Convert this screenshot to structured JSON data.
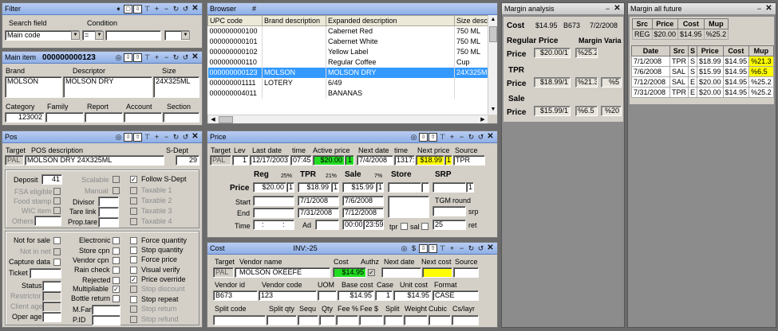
{
  "filter": {
    "title": "Filter",
    "search_field_label": "Search field",
    "condition_label": "Condition",
    "search_field_value": "Main code",
    "condition_value": "="
  },
  "main_item": {
    "title": "Main item",
    "code": "000000000123",
    "brand_label": "Brand",
    "descriptor_label": "Descriptor",
    "size_label": "Size",
    "brand": "MOLSON",
    "descriptor": "MOLSON DRY",
    "size": "24X325ML",
    "category_label": "Category",
    "family_label": "Family",
    "report_label": "Report",
    "account_label": "Account",
    "section_label": "Section",
    "category": "123002"
  },
  "pos": {
    "title": "Pos",
    "target_label": "Target",
    "pos_desc_label": "POS description",
    "sdept_label": "S-Dept",
    "target": "PAL",
    "pos_desc": "MOLSON DRY 24X325ML",
    "sdept": "29",
    "deposit_label": "Deposit",
    "deposit": "41",
    "fsa_label": "FSA eligible",
    "food_stamp_label": "Food stamp",
    "wic_label": "WIC item",
    "others_label": "Others",
    "scalable_label": "Scalable",
    "manual_label": "Manual",
    "divisor_label": "Divisor",
    "tare_link_label": "Tare link",
    "prop_tare_label": "Prop.tare",
    "follow_sdept_label": "Follow S-Dept",
    "taxables": [
      "Taxable 1",
      "Taxable 2",
      "Taxable 3",
      "Taxable 4"
    ],
    "not_for_sale_label": "Not for sale",
    "not_in_net_label": "Not in net",
    "capture_data_label": "Capture data",
    "ticket_label": "Ticket",
    "status_label": "Status",
    "restrictor_label": "Restrictor",
    "client_age_label": "Client age",
    "oper_age_label": "Oper age",
    "electronic_label": "Electronic",
    "store_cpn_label": "Store cpn",
    "vendor_cpn_label": "Vendor cpn",
    "rain_check_label": "Rain check",
    "rejected_label": "Rejected",
    "multipliable_label": "Multipliable",
    "bottle_return_label": "Bottle return",
    "mfam_label": "M.Fam.",
    "pid_label": "P.ID",
    "right_opts": [
      "Force quantity",
      "Stop quantity",
      "Force price",
      "Visual verify",
      "Price override",
      "Stop discount",
      "Stop repeat",
      "Stop return",
      "Stop refund"
    ]
  },
  "browser": {
    "title": "Browser",
    "hash": "#",
    "columns": [
      "UPC code",
      "Brand description",
      "Expanded description",
      "Size desc"
    ],
    "rows": [
      [
        "000000000100",
        "",
        "Cabernet Red",
        "750 ML"
      ],
      [
        "000000000101",
        "",
        "Cabernet White",
        "750 ML"
      ],
      [
        "000000000102",
        "",
        "Yellow Label",
        "750 ML"
      ],
      [
        "000000000110",
        "",
        "Regular Coffee",
        "Cup"
      ],
      [
        "000000000123",
        "MOLSON",
        "MOLSON DRY",
        "24X325M"
      ],
      [
        "000000001111",
        "LOTERY",
        "6/49",
        ""
      ],
      [
        "000000004011",
        "",
        "BANANAS",
        ""
      ]
    ]
  },
  "price": {
    "title": "Price",
    "target_label": "Target",
    "lev_label": "Lev",
    "last_date_label": "Last date",
    "time_label": "time",
    "active_price_label": "Active price",
    "next_date_label": "Next date",
    "next_price_label": "Next price",
    "source_label": "Source",
    "target": "PAL",
    "lev": "1",
    "last_date": "12/17/2003",
    "last_time": "07:45",
    "active_price": "$20.00",
    "active_qty": "1",
    "next_date": "7/4/2008",
    "next_time": "1317:",
    "next_price": "$18.99",
    "next_qty": "1",
    "source": "TPR",
    "reg_label": "Reg",
    "reg_pct": "25%",
    "tpr_label": "TPR",
    "tpr_pct": "21%",
    "sale_label": "Sale",
    "sale_pct": "7%",
    "store_label": "Store",
    "srp_label": "SRP",
    "price_label": "Price",
    "reg_price": "$20.00",
    "reg_qty": "1",
    "tpr_price": "$18.99",
    "tpr_qty": "1",
    "sale_price": "$15.99",
    "sale_qty": "1",
    "srp_qty": "1",
    "start_label": "Start",
    "end_label": "End",
    "time_row_label": "Time",
    "tpr_start": "7/1/2008",
    "tpr_end": "7/31/2008",
    "ad_label": "Ad",
    "sale_start": "7/6/2008",
    "sale_end": "7/12/2008",
    "sale_time_start": "00:00",
    "sale_time_end": "23:59",
    "colon": ":",
    "tgm_label": "TGM",
    "round_label": "round",
    "srp_small": "srp",
    "ret_label": "ret",
    "tgm_value": "25",
    "tpr_check_label": "tpr",
    "sal_check_label": "sal"
  },
  "cost": {
    "title": "Cost",
    "inv": "INV:-25",
    "target_label": "Target",
    "vendor_name_label": "Vendor name",
    "cost_label": "Cost",
    "authz_label": "Authz",
    "next_date_label": "Next date",
    "next_cost_label": "Next cost",
    "source_label": "Source",
    "target": "PAL",
    "vendor_name": "MOLSON OKEEFE",
    "cost": "$14.95",
    "vendor_id_label": "Vendor id",
    "vendor_code_label": "Vendor code",
    "uom_label": "UOM",
    "base_cost_label": "Base cost",
    "case_label": "Case",
    "unit_cost_label": "Unit cost",
    "format_label": "Format",
    "vendor_id": "B673",
    "vendor_code": "123",
    "base_cost": "$14.95",
    "case": "1",
    "unit_cost": "$14.95",
    "format": "CASE",
    "split_code_label": "Split code",
    "split_qty_label": "Split qty",
    "sequ_label": "Sequ",
    "qty_label": "Qty",
    "fee_pct_label": "Fee %",
    "fee_amt_label": "Fee $",
    "split_label": "Split",
    "weight_label": "Weight",
    "cubic_label": "Cubic",
    "cs_layr_label": "Cs/layr"
  },
  "margin_analysis": {
    "title": "Margin analysis",
    "cost_label": "Cost",
    "cost": "$14.95",
    "vendor": "B673",
    "date": "7/2/2008",
    "regular_price_label": "Regular Price",
    "margin_label": "Margin Varia",
    "price_label": "Price",
    "reg_price": "$20.00/1",
    "reg_margin": "%25.2",
    "tpr_label": "TPR",
    "tpr_price": "$18.99/1",
    "tpr_margin": "%21.3",
    "tpr_var": "%5",
    "sale_label": "Sale",
    "sale_price": "$15.99/1",
    "sale_margin": "%6.5",
    "sale_var": "%20"
  },
  "margin_future": {
    "title": "Margin all future",
    "top_headers": [
      "Src",
      "Price",
      "Cost",
      "Mup"
    ],
    "top_row": [
      "REG",
      "$20.00",
      "$14.95",
      "%25.2"
    ],
    "headers": [
      "Date",
      "Src",
      "S",
      "Price",
      "Cost",
      "Mup"
    ],
    "rows": [
      [
        "7/1/2008",
        "TPR",
        "S",
        "$18.99",
        "$14.95",
        "%21.3"
      ],
      [
        "7/6/2008",
        "SAL",
        "S",
        "$15.99",
        "$14.95",
        "%6.5"
      ],
      [
        "7/12/2008",
        "SAL",
        "E",
        "$20.00",
        "$14.95",
        "%25.2"
      ],
      [
        "7/31/2008",
        "TPR",
        "E",
        "$20.00",
        "$14.95",
        "%25.2"
      ]
    ],
    "highlight_color": "#ffff00"
  },
  "colors": {
    "title_bar": "#8fb0e6",
    "active_price_bg": "#22dd22",
    "next_price_bg": "#ffff00",
    "selection": "#3399ff"
  }
}
